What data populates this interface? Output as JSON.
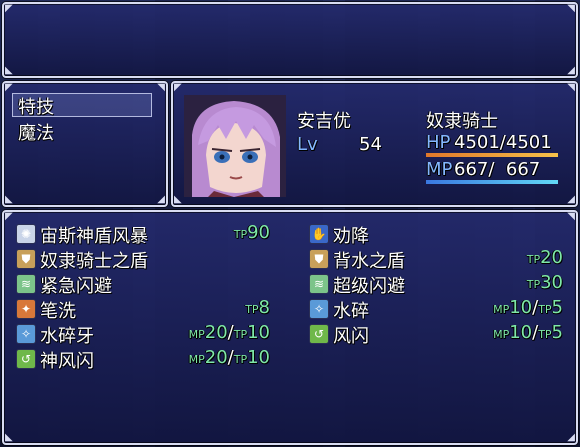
{
  "help": {
    "text": ""
  },
  "commands": [
    {
      "label": "特技",
      "selected": true
    },
    {
      "label": "魔法",
      "selected": false
    }
  ],
  "actor": {
    "name": "安吉优",
    "class": "奴隶骑士",
    "level_label": "Lv",
    "level": "54",
    "hp_label": "HP",
    "hp_value": "4501/4501",
    "hp_fraction": 1.0,
    "mp_label": "MP",
    "mp_value": "667/  667",
    "mp_fraction": 1.0
  },
  "skills": [
    {
      "name": "宙斯神盾风暴",
      "icon": "storm-icon",
      "cost": [
        {
          "unit": "TP",
          "amount": "90"
        }
      ]
    },
    {
      "name": "劝降",
      "icon": "surrender-icon",
      "cost": []
    },
    {
      "name": "奴隶骑士之盾",
      "icon": "shield-icon",
      "cost": []
    },
    {
      "name": "背水之盾",
      "icon": "shield-icon",
      "cost": [
        {
          "unit": "TP",
          "amount": "20"
        }
      ]
    },
    {
      "name": "紧急闪避",
      "icon": "evade-icon",
      "cost": []
    },
    {
      "name": "超级闪避",
      "icon": "evade-icon",
      "cost": [
        {
          "unit": "TP",
          "amount": "30"
        }
      ]
    },
    {
      "name": "笔洗",
      "icon": "slash-icon",
      "cost": [
        {
          "unit": "TP",
          "amount": "8"
        }
      ]
    },
    {
      "name": "水碎",
      "icon": "water-icon",
      "cost": [
        {
          "unit": "MP",
          "amount": "10"
        },
        {
          "unit": "TP",
          "amount": "5"
        }
      ]
    },
    {
      "name": "水碎牙",
      "icon": "water-icon",
      "cost": [
        {
          "unit": "MP",
          "amount": "20"
        },
        {
          "unit": "TP",
          "amount": "10"
        }
      ]
    },
    {
      "name": "风闪",
      "icon": "wind-icon",
      "cost": [
        {
          "unit": "MP",
          "amount": "10"
        },
        {
          "unit": "TP",
          "amount": "5"
        }
      ]
    },
    {
      "name": "神风闪",
      "icon": "wind-icon",
      "cost": [
        {
          "unit": "MP",
          "amount": "20"
        },
        {
          "unit": "TP",
          "amount": "10"
        }
      ]
    }
  ]
}
